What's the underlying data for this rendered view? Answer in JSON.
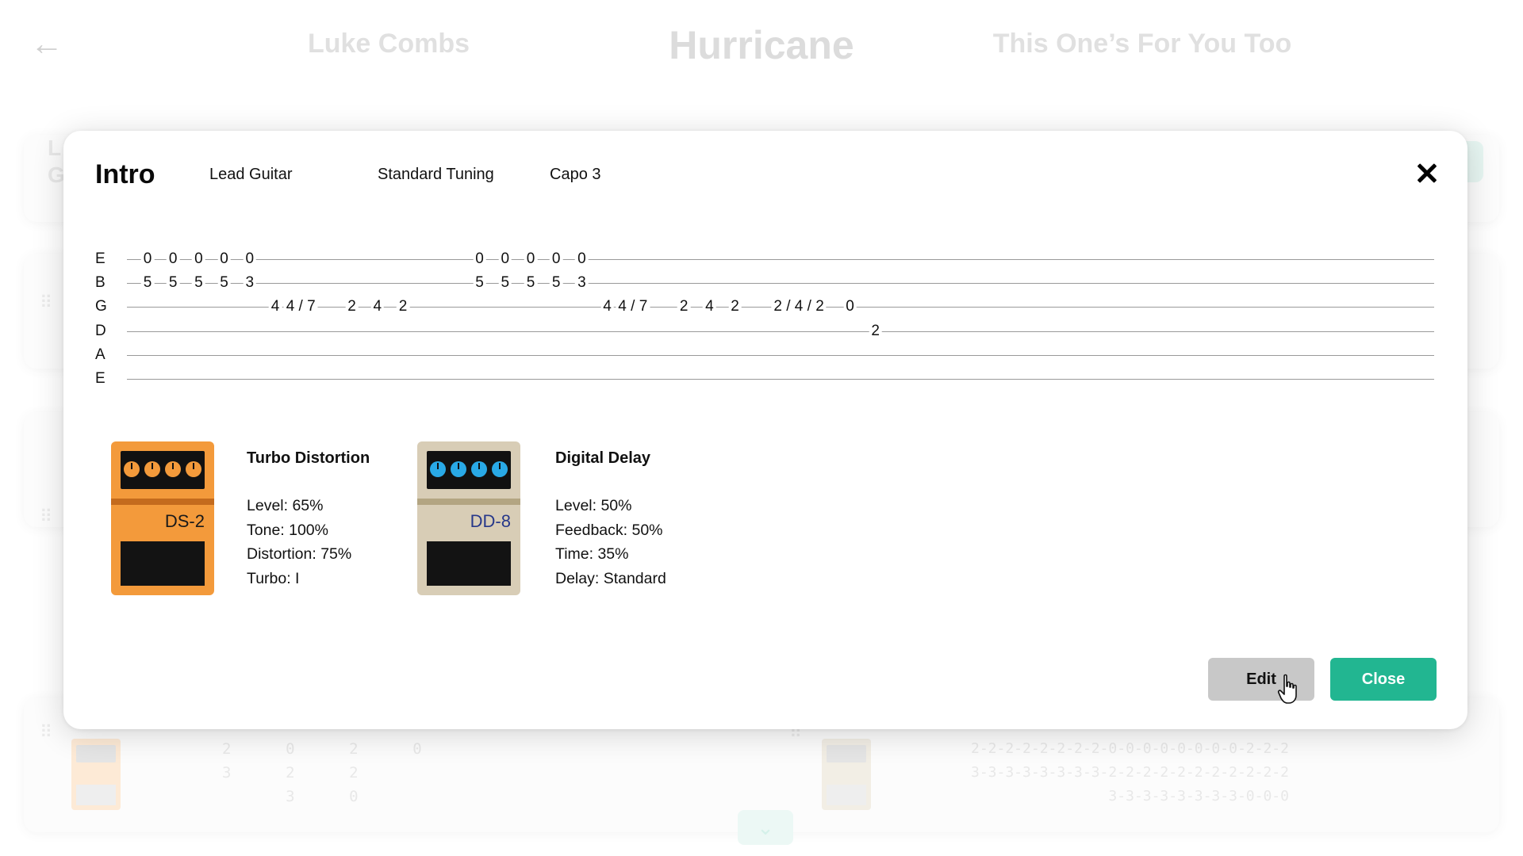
{
  "background": {
    "prev_song": "Luke Combs",
    "title": "Hurricane",
    "next_song": "This One’s For You Too",
    "card_initials": [
      "L",
      "G"
    ],
    "bg_tab_left": [
      "2      0      2      0",
      "3      2      2",
      "       3      0"
    ],
    "bg_tab_right": [
      "2-2-2-2-2-2-2-2-0-0-0-0-0-0-0-0-2-2-2",
      "3-3-3-3-3-3-3-3-2-2-2-2-2-2-2-2-2-2-2",
      "                3-3-3-3-3-3-3-3-0-0-0"
    ]
  },
  "modal": {
    "section": "Intro",
    "part": "Lead Guitar",
    "tuning": "Standard Tuning",
    "capo": "Capo 3",
    "close_icon": "close-x-icon"
  },
  "tab": {
    "strings": [
      {
        "name": "E",
        "notes": [
          {
            "fret": "0",
            "pos": 1
          },
          {
            "fret": "0",
            "pos": 2
          },
          {
            "fret": "0",
            "pos": 3
          },
          {
            "fret": "0",
            "pos": 4
          },
          {
            "fret": "0",
            "pos": 5
          },
          {
            "fret": "0",
            "pos": 14
          },
          {
            "fret": "0",
            "pos": 15
          },
          {
            "fret": "0",
            "pos": 16
          },
          {
            "fret": "0",
            "pos": 17
          },
          {
            "fret": "0",
            "pos": 18
          }
        ]
      },
      {
        "name": "B",
        "notes": [
          {
            "fret": "5",
            "pos": 1
          },
          {
            "fret": "5",
            "pos": 2
          },
          {
            "fret": "5",
            "pos": 3
          },
          {
            "fret": "5",
            "pos": 4
          },
          {
            "fret": "3",
            "pos": 5
          },
          {
            "fret": "5",
            "pos": 14
          },
          {
            "fret": "5",
            "pos": 15
          },
          {
            "fret": "5",
            "pos": 16
          },
          {
            "fret": "5",
            "pos": 17
          },
          {
            "fret": "3",
            "pos": 18
          }
        ]
      },
      {
        "name": "G",
        "notes": [
          {
            "fret": "4",
            "pos": 6
          },
          {
            "fret": "4 / 7",
            "pos": 7
          },
          {
            "fret": "2",
            "pos": 9
          },
          {
            "fret": "4",
            "pos": 10
          },
          {
            "fret": "2",
            "pos": 11
          },
          {
            "fret": "4",
            "pos": 19
          },
          {
            "fret": "4 / 7",
            "pos": 20
          },
          {
            "fret": "2",
            "pos": 22
          },
          {
            "fret": "4",
            "pos": 23
          },
          {
            "fret": "2",
            "pos": 24
          },
          {
            "fret": "2 / 4 / 2",
            "pos": 26.5
          },
          {
            "fret": "0",
            "pos": 28.5
          }
        ]
      },
      {
        "name": "D",
        "notes": [
          {
            "fret": "2",
            "pos": 29.5
          }
        ]
      },
      {
        "name": "A",
        "notes": []
      },
      {
        "name": "E",
        "notes": []
      }
    ]
  },
  "pedals": [
    {
      "model": "DS-2",
      "name": "Turbo Distortion",
      "body_color": "#f39a3b",
      "knob_color": "#f39a3b",
      "settings": [
        "Level: 65%",
        "Tone: 100%",
        "Distortion: 75%",
        "Turbo: I"
      ]
    },
    {
      "model": "DD-8",
      "name": "Digital Delay",
      "body_color": "#d8cdb6",
      "knob_color": "#29a9e6",
      "settings": [
        "Level: 50%",
        "Feedback: 50%",
        "Time: 35%",
        "Delay: Standard"
      ]
    }
  ],
  "buttons": {
    "edit": "Edit",
    "close": "Close"
  },
  "colors": {
    "accent": "#22b691",
    "edit_button": "#c8c8c8"
  }
}
